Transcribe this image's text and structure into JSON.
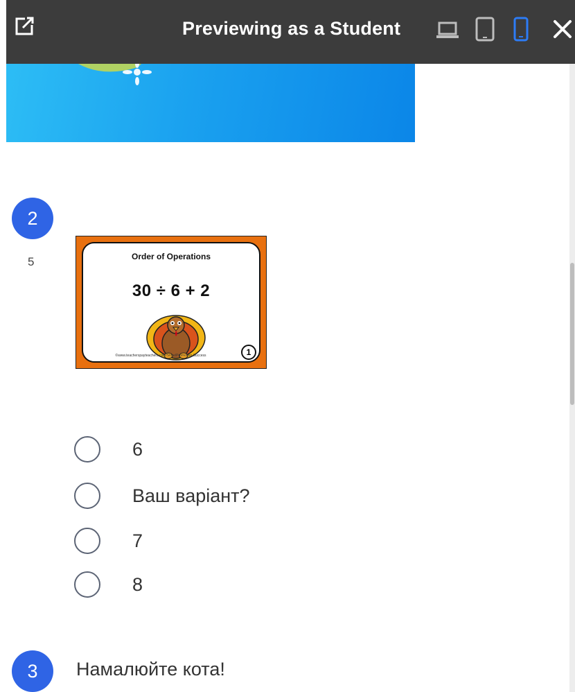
{
  "header": {
    "title": "Previewing as a Student",
    "icons": [
      "open-external-icon",
      "laptop-icon",
      "tablet-icon",
      "phone-icon",
      "close-icon"
    ],
    "active_device": "phone",
    "active_color": "#2d7cf6",
    "bg_color": "#3c3c3c"
  },
  "question2": {
    "number": "2",
    "points": "5",
    "card": {
      "title": "Order of Operations",
      "expression": "30 ÷ 6 + 2",
      "footer": "©www.teacherspayteachers.com/Store/Promoting-Success",
      "card_number": "1"
    },
    "options": [
      "6",
      "Ваш варіант?",
      "7",
      "8"
    ]
  },
  "question3": {
    "number": "3",
    "text": "Намалюйте кота!"
  },
  "colors": {
    "accent": "#2f64e5",
    "banner_from": "#2dbdf5",
    "banner_to": "#0b86e8",
    "card_orange": "#e8700f"
  }
}
